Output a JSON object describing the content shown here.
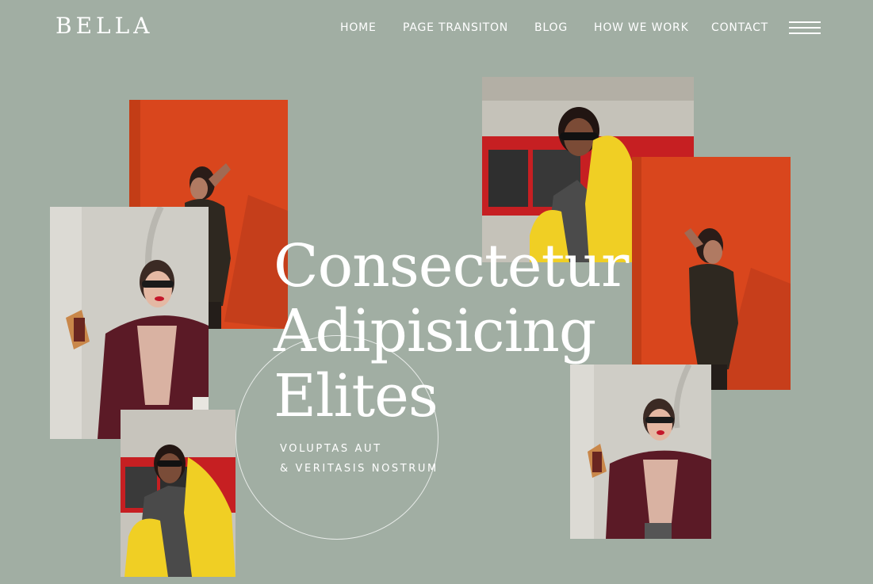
{
  "brand": {
    "logo": "BELLA"
  },
  "nav": {
    "items": [
      {
        "label": "HOME"
      },
      {
        "label": "PAGE TRANSITON"
      },
      {
        "label": "BLOG"
      },
      {
        "label": "HOW WE WORK"
      },
      {
        "label": "CONTACT"
      }
    ],
    "menu_icon": "hamburger-icon"
  },
  "hero": {
    "title_lines": [
      "Consectetur",
      "Adipisicing",
      "Elites"
    ],
    "subtitle_lines": [
      "VOLUPTAS AUT",
      "& VERITASIS NOSTRUM"
    ]
  },
  "colors": {
    "background": "#a1aea3",
    "text": "#ffffff",
    "orange_wall": "#d9461d",
    "yellow_jacket": "#f0cf24",
    "red_trim": "#c61f22",
    "burgundy_coat": "#5b1a26",
    "grey_wall": "#cfcdc6"
  }
}
